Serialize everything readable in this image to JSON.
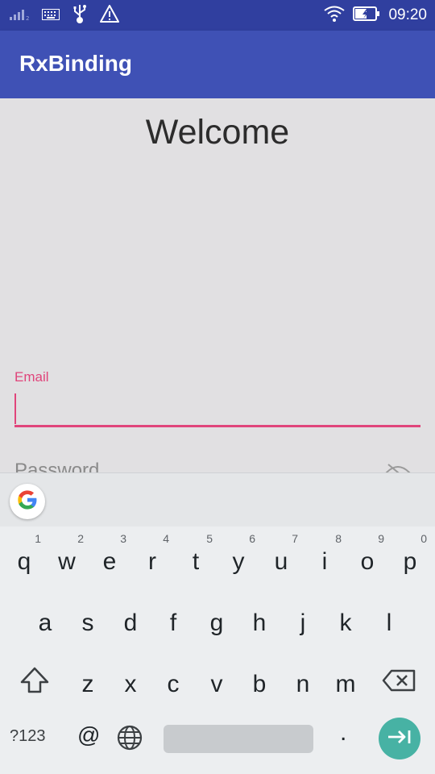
{
  "status_bar": {
    "time": "09:20",
    "icons": [
      "signal-icon",
      "keyboard-icon",
      "usb-icon",
      "warning-icon",
      "wifi-icon",
      "battery-charging-icon"
    ]
  },
  "app_bar": {
    "title": "RxBinding"
  },
  "content": {
    "heading": "Welcome",
    "email_label": "Email",
    "email_value": "",
    "password_placeholder": "Password"
  },
  "keyboard": {
    "row1": [
      {
        "ch": "q",
        "num": "1"
      },
      {
        "ch": "w",
        "num": "2"
      },
      {
        "ch": "e",
        "num": "3"
      },
      {
        "ch": "r",
        "num": "4"
      },
      {
        "ch": "t",
        "num": "5"
      },
      {
        "ch": "y",
        "num": "6"
      },
      {
        "ch": "u",
        "num": "7"
      },
      {
        "ch": "i",
        "num": "8"
      },
      {
        "ch": "o",
        "num": "9"
      },
      {
        "ch": "p",
        "num": "0"
      }
    ],
    "row2": [
      "a",
      "s",
      "d",
      "f",
      "g",
      "h",
      "j",
      "k",
      "l"
    ],
    "row3": [
      "z",
      "x",
      "c",
      "v",
      "b",
      "n",
      "m"
    ],
    "symbols_label": "?123",
    "at_label": "@",
    "period_label": "."
  },
  "colors": {
    "status_bar": "#303f9f",
    "app_bar": "#3f51b5",
    "accent": "#e0457b",
    "enter_key": "#47b2a4"
  }
}
